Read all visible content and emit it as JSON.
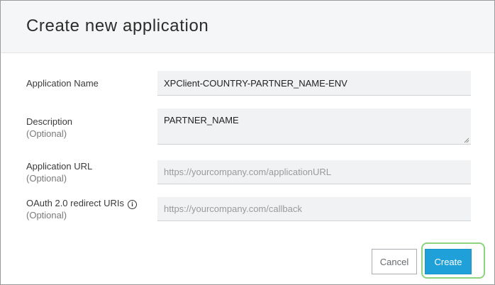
{
  "dialog": {
    "title": "Create new application"
  },
  "form": {
    "app_name": {
      "label": "Application Name",
      "value": "XPClient-COUNTRY-PARTNER_NAME-ENV"
    },
    "description": {
      "label": "Description",
      "optional": "(Optional)",
      "value": "PARTNER_NAME"
    },
    "app_url": {
      "label": "Application URL",
      "optional": "(Optional)",
      "placeholder": "https://yourcompany.com/applicationURL"
    },
    "redirect_uris": {
      "label": "OAuth 2.0 redirect URIs",
      "optional": "(Optional)",
      "info_icon": "info-icon",
      "info_glyph": "i",
      "placeholder": "https://yourcompany.com/callback"
    }
  },
  "actions": {
    "cancel_label": "Cancel",
    "create_label": "Create"
  },
  "colors": {
    "primary": "#1fa0d9",
    "highlight": "#8ed37d",
    "header_bg": "#f5f6f7",
    "field_bg": "#f1f2f3"
  }
}
